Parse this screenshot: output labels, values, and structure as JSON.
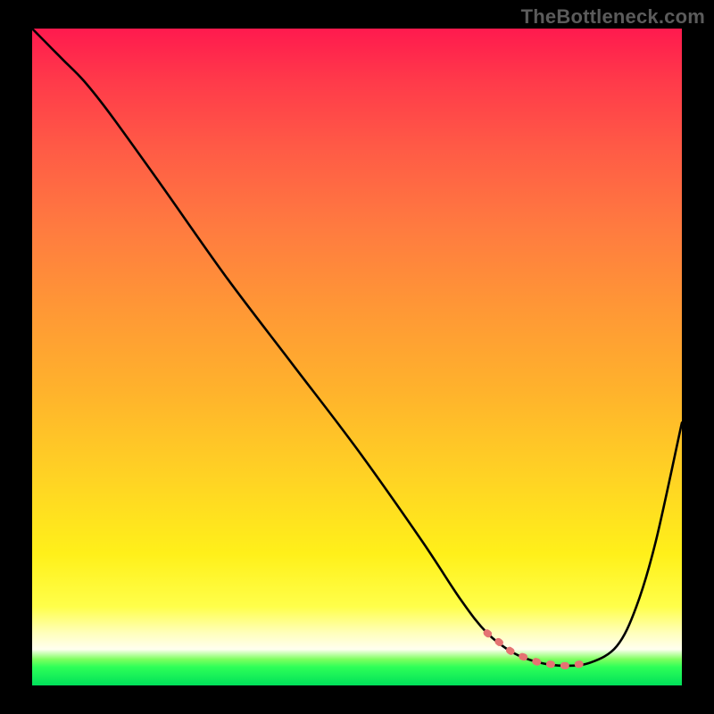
{
  "watermark": "TheBottleneck.com",
  "chart_data": {
    "type": "line",
    "title": "",
    "xlabel": "",
    "ylabel": "",
    "xlim": [
      0,
      100
    ],
    "ylim": [
      0,
      100
    ],
    "grid": false,
    "legend": false,
    "series": [
      {
        "name": "curve",
        "color": "#000000",
        "x": [
          0,
          3,
          5,
          8,
          12,
          20,
          30,
          40,
          50,
          60,
          66,
          70,
          74,
          78,
          82,
          86,
          90,
          93,
          96,
          100
        ],
        "y": [
          100,
          97,
          95,
          92,
          87,
          76,
          62,
          49,
          36,
          22,
          13,
          8,
          5,
          3.5,
          3,
          3.5,
          6,
          12,
          22,
          40
        ]
      },
      {
        "name": "highlight",
        "color": "#e57373",
        "x": [
          70,
          72,
          74,
          76,
          78,
          80,
          82,
          84,
          86
        ],
        "y": [
          8,
          6.5,
          5,
          4.2,
          3.5,
          3.2,
          3,
          3.2,
          3.5
        ]
      }
    ],
    "background_gradient": {
      "direction": "vertical",
      "stops": [
        {
          "pos": 0.0,
          "color": "#ff1a4e"
        },
        {
          "pos": 0.3,
          "color": "#ff7a40"
        },
        {
          "pos": 0.68,
          "color": "#ffd224"
        },
        {
          "pos": 0.88,
          "color": "#ffff4a"
        },
        {
          "pos": 0.96,
          "color": "#7fff60"
        },
        {
          "pos": 1.0,
          "color": "#00e05a"
        }
      ]
    }
  }
}
